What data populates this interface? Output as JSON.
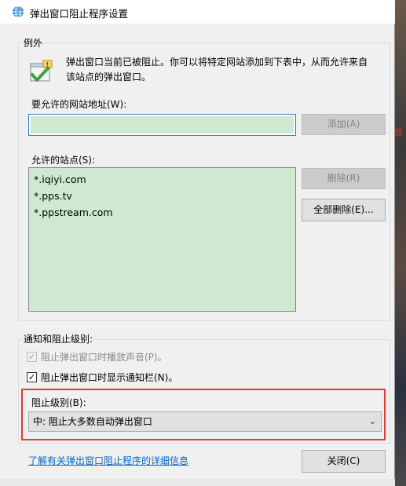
{
  "window": {
    "title": "弹出窗口阻止程序设置"
  },
  "exceptions": {
    "group_label": "例外",
    "description_line1": "弹出窗口当前已被阻止。你可以将特定网站添加到下表中，从而允许来自",
    "description_line2": "该站点的弹出窗口。",
    "address_label": "要允许的网站地址(W):",
    "address_value": "",
    "add_button": "添加(A)",
    "sites_label": "允许的站点(S):",
    "sites": [
      "*.iqiyi.com",
      "*.pps.tv",
      "*.ppstream.com"
    ],
    "remove_button": "删除(R)",
    "remove_all_button": "全部删除(E)..."
  },
  "notifications": {
    "group_label": "通知和阻止级别:",
    "play_sound_label": "阻止弹出窗口时播放声音(P)。",
    "play_sound_checked": true,
    "show_bar_label": "阻止弹出窗口时显示通知栏(N)。",
    "show_bar_checked": true,
    "block_level_label": "阻止级别(B):",
    "block_level_value": "中: 阻止大多数自动弹出窗口"
  },
  "footer": {
    "learn_more_link": "了解有关弹出窗口阻止程序的详细信息",
    "close_button": "关闭(C)"
  },
  "background": {
    "edge_text": "扳"
  },
  "colors": {
    "highlight_border": "#e53935",
    "list_background": "#cfe8cf",
    "link": "#0066cc"
  }
}
